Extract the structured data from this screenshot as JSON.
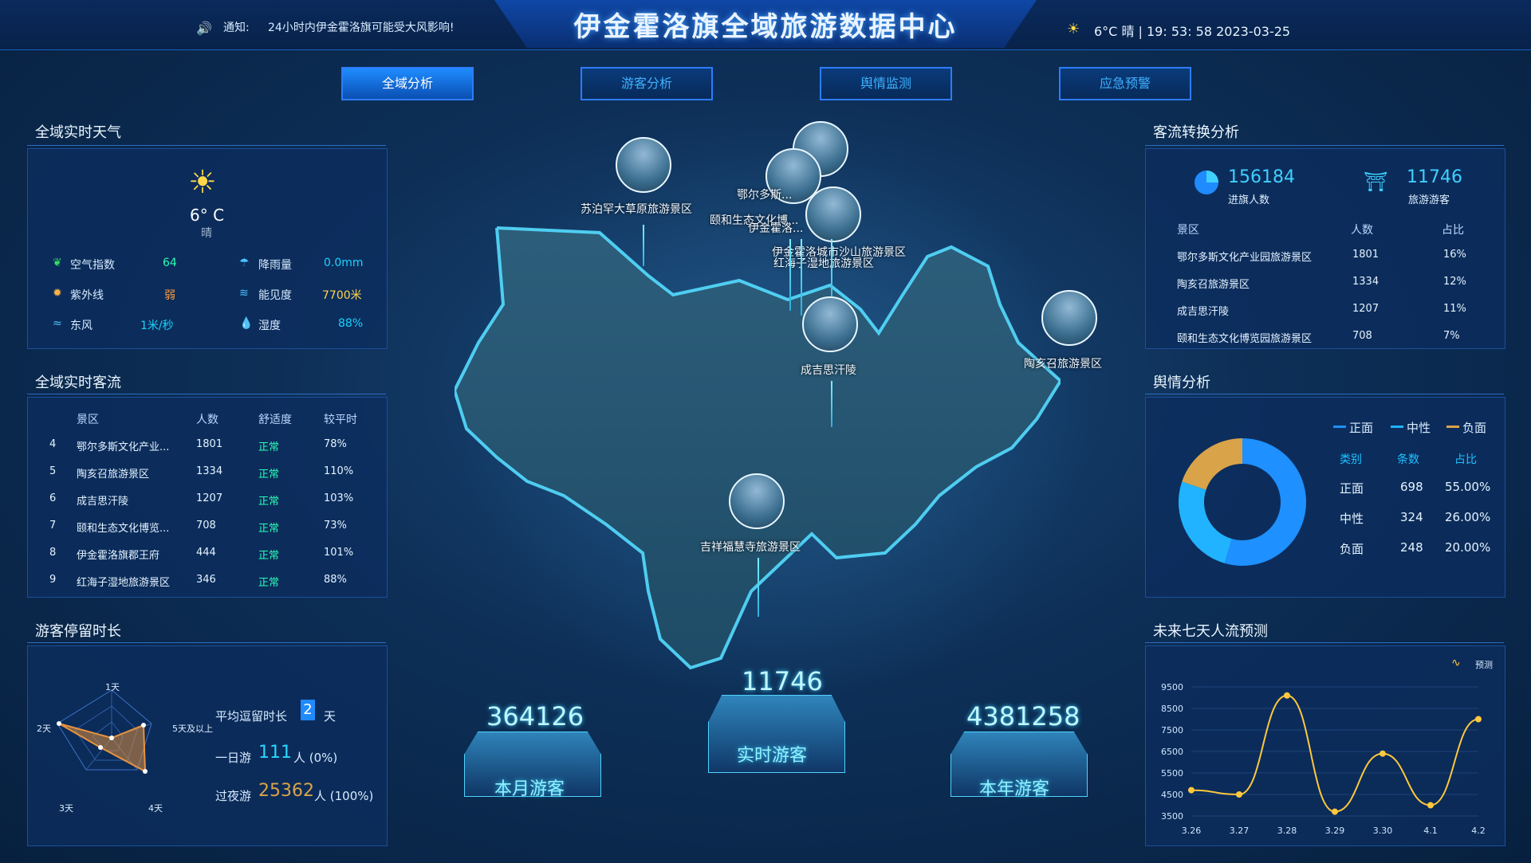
{
  "header": {
    "title": "伊金霍洛旗全域旅游数据中心",
    "notice_label": "通知:",
    "notice_text": "24小时内伊金霍洛旗可能受大风影响!",
    "weather_summary": "6°C  晴  |  19: 53: 58  2023-03-25"
  },
  "tabs": [
    {
      "label": "全域分析"
    },
    {
      "label": "游客分析"
    },
    {
      "label": "舆情监测"
    },
    {
      "label": "应急预警"
    }
  ],
  "weather_panel": {
    "title": "全域实时天气",
    "temp": "6° C",
    "condition": "晴",
    "metrics": [
      {
        "label": "空气指数",
        "value": "64"
      },
      {
        "label": "降雨量",
        "value": "0.0mm"
      },
      {
        "label": "紫外线",
        "value": "弱"
      },
      {
        "label": "能见度",
        "value": "7700米"
      },
      {
        "label": "东风",
        "value": "1米/秒"
      },
      {
        "label": "湿度",
        "value": "88%"
      }
    ]
  },
  "flow_panel": {
    "title": "全域实时客流",
    "headers": [
      "景区",
      "人数",
      "舒适度",
      "较平时"
    ],
    "rows": [
      {
        "rank": "4",
        "name": "鄂尔多斯文化产业...",
        "count": "1801",
        "comfort": "正常",
        "ratio": "78%"
      },
      {
        "rank": "5",
        "name": "陶亥召旅游景区",
        "count": "1334",
        "comfort": "正常",
        "ratio": "110%"
      },
      {
        "rank": "6",
        "name": "成吉思汗陵",
        "count": "1207",
        "comfort": "正常",
        "ratio": "103%"
      },
      {
        "rank": "7",
        "name": "颐和生态文化博览...",
        "count": "708",
        "comfort": "正常",
        "ratio": "73%"
      },
      {
        "rank": "8",
        "name": "伊金霍洛旗郡王府",
        "count": "444",
        "comfort": "正常",
        "ratio": "101%"
      },
      {
        "rank": "9",
        "name": "红海子湿地旅游景区",
        "count": "346",
        "comfort": "正常",
        "ratio": "88%"
      }
    ]
  },
  "stay_panel": {
    "title": "游客停留时长",
    "radar_labels": [
      "1天",
      "2天",
      "3天",
      "4天",
      "5天及以上"
    ],
    "avg_label": "平均逗留时长",
    "avg_value": "2",
    "avg_unit": "天",
    "day_label": "一日游",
    "day_value": "111",
    "day_unit": "人 (0%)",
    "overnight_label": "过夜游",
    "overnight_value": "25362",
    "overnight_unit": "人 (100%)"
  },
  "map": {
    "scenic": [
      {
        "name": "苏泊罕大草原旅游景区"
      },
      {
        "name": "鄂尔多斯..."
      },
      {
        "name": "颐和生态文化博..."
      },
      {
        "name": "伊金霍洛..."
      },
      {
        "name": "伊金霍洛城市沙山旅游景区"
      },
      {
        "name": "红海子湿地旅游景区"
      },
      {
        "name": "成吉思汗陵"
      },
      {
        "name": "陶亥召旅游景区"
      },
      {
        "name": "吉祥福慧寺旅游景区"
      }
    ],
    "stats": {
      "month": {
        "value": "364126",
        "label": "本月游客"
      },
      "realtime": {
        "value": "11746",
        "label": "实时游客"
      },
      "year": {
        "value": "4381258",
        "label": "本年游客"
      }
    }
  },
  "conversion_panel": {
    "title": "客流转换分析",
    "in_value": "156184",
    "in_label": "进旗人数",
    "tour_value": "11746",
    "tour_label": "旅游游客",
    "headers": [
      "景区",
      "人数",
      "占比"
    ],
    "rows": [
      {
        "name": "鄂尔多斯文化产业园旅游景区",
        "count": "1801",
        "ratio": "16%"
      },
      {
        "name": "陶亥召旅游景区",
        "count": "1334",
        "ratio": "12%"
      },
      {
        "name": "成吉思汗陵",
        "count": "1207",
        "ratio": "11%"
      },
      {
        "name": "颐和生态文化博览园旅游景区",
        "count": "708",
        "ratio": "7%"
      }
    ]
  },
  "sentiment_panel": {
    "title": "舆情分析",
    "legend": [
      {
        "label": "正面",
        "color": "#1e90ff"
      },
      {
        "label": "中性",
        "color": "#21b3ff"
      },
      {
        "label": "负面",
        "color": "#d9a349"
      }
    ],
    "headers": [
      "类别",
      "条数",
      "占比"
    ],
    "rows": [
      {
        "type": "正面",
        "count": "698",
        "ratio": "55.00%"
      },
      {
        "type": "中性",
        "count": "324",
        "ratio": "26.00%"
      },
      {
        "type": "负面",
        "count": "248",
        "ratio": "20.00%"
      }
    ],
    "chart_data": {
      "type": "pie",
      "values": [
        55,
        26,
        20
      ],
      "categories": [
        "正面",
        "中性",
        "负面"
      ]
    }
  },
  "forecast_panel": {
    "title": "未来七天人流预测",
    "legend_label": "预测",
    "chart_data": {
      "type": "line",
      "categories": [
        "3.26",
        "3.27",
        "3.28",
        "3.29",
        "3.30",
        "4.1",
        "4.2"
      ],
      "values": [
        4700,
        4500,
        9100,
        3700,
        6400,
        4000,
        8000
      ],
      "y_ticks": [
        "3500",
        "4500",
        "5500",
        "6500",
        "7500",
        "8500",
        "9500"
      ],
      "ylim": [
        3500,
        9500
      ]
    }
  }
}
